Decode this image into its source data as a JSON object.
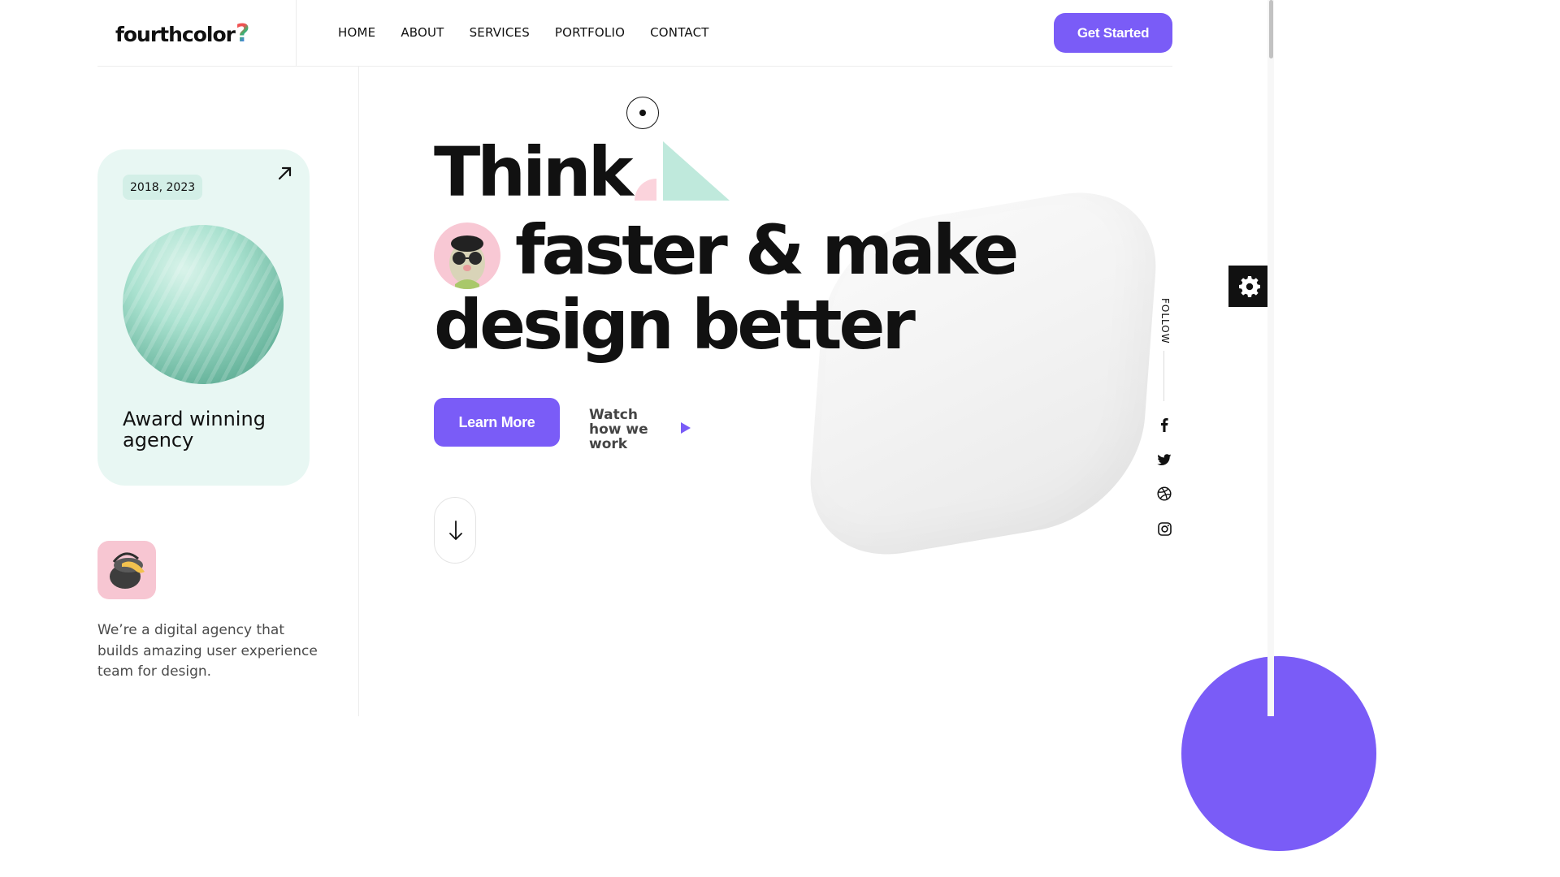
{
  "header": {
    "logo_text": "fourthcolor",
    "logo_mark": "?",
    "nav": [
      "HOME",
      "ABOUT",
      "SERVICES",
      "PORTFOLIO",
      "CONTACT"
    ],
    "cta_label": "Get Started"
  },
  "award_card": {
    "years": "2018, 2023",
    "title": "Award winning agency",
    "arrow_icon": "arrow-up-right-icon"
  },
  "intro": {
    "text": "We’re a digital agency that builds amazing user experience team for design."
  },
  "hero": {
    "line1": "Think",
    "line2": "faster & make",
    "line3": "design better",
    "primary_button": "Learn More",
    "secondary_link": "Watch how we work"
  },
  "social": {
    "label": "FOLLOW",
    "icons": [
      "facebook-icon",
      "twitter-icon",
      "dribbble-icon",
      "instagram-icon"
    ]
  },
  "colors": {
    "accent": "#7a5cf7",
    "card_bg": "#e8f7f3",
    "mint": "#bfe9dc",
    "pink": "#f8c8d4"
  }
}
